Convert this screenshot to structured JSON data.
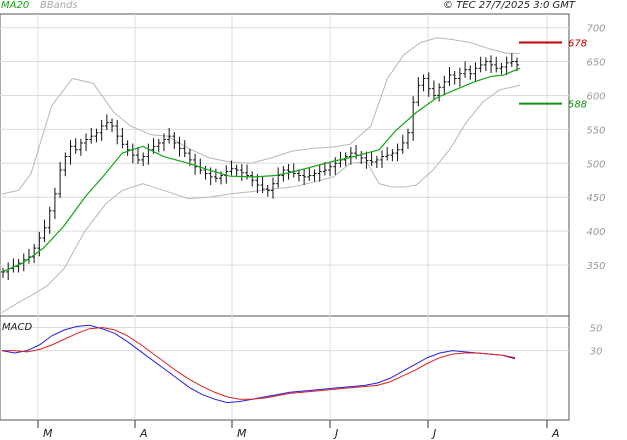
{
  "header": {
    "ma_label": "MA20",
    "bbands_label": "BBands",
    "copyright": "© TEC 27/7/2025 3:0 GMT"
  },
  "macd_label": "MACD",
  "colors": {
    "ma20": "#13a513",
    "bbands": "#b8b8b8",
    "bars": "#111111",
    "resistance": "#c00000",
    "support": "#109010",
    "macd": "#2222dd",
    "signal": "#dd2222",
    "grid": "#dcdcdc"
  },
  "chart_data": [
    {
      "type": "ohlc",
      "title": "",
      "x_tick_labels": [
        "M",
        "A",
        "M",
        "J",
        "J",
        "A"
      ],
      "y_tick_labels": [
        350,
        400,
        450,
        500,
        550,
        600,
        650,
        700
      ],
      "ylim": [
        275,
        720
      ],
      "grid": true,
      "series": [
        {
          "name": "MA20",
          "kind": "line",
          "x": [
            0,
            10,
            20,
            30,
            40,
            50,
            58,
            68,
            78,
            90,
            100,
            110,
            122,
            132,
            140,
            150,
            160,
            170,
            182,
            190,
            200,
            210,
            220,
            228,
            236,
            242,
            250
          ],
          "y": [
            340,
            353,
            375,
            408,
            450,
            485,
            515,
            525,
            510,
            500,
            490,
            481,
            480,
            482,
            487,
            495,
            503,
            510,
            520,
            548,
            575,
            597,
            610,
            620,
            628,
            630,
            640
          ]
        },
        {
          "name": "BBands upper",
          "kind": "line",
          "x": [
            0,
            8,
            14,
            24,
            34,
            44,
            54,
            62,
            72,
            80,
            90,
            100,
            110,
            120,
            130,
            140,
            150,
            160,
            168,
            178,
            186,
            194,
            202,
            210,
            218,
            226,
            236,
            244,
            250
          ],
          "y": [
            455,
            460,
            485,
            585,
            625,
            618,
            575,
            555,
            542,
            540,
            522,
            508,
            502,
            500,
            508,
            518,
            522,
            524,
            528,
            555,
            625,
            660,
            678,
            685,
            682,
            678,
            668,
            662,
            662
          ]
        },
        {
          "name": "BBands lower",
          "kind": "line",
          "x": [
            0,
            8,
            14,
            22,
            30,
            40,
            50,
            58,
            68,
            80,
            90,
            100,
            110,
            120,
            130,
            140,
            150,
            160,
            168,
            176,
            182,
            188,
            194,
            200,
            208,
            216,
            224,
            232,
            240,
            250
          ],
          "y": [
            280,
            295,
            305,
            320,
            345,
            400,
            440,
            460,
            470,
            458,
            448,
            450,
            455,
            458,
            462,
            465,
            472,
            480,
            500,
            502,
            470,
            465,
            465,
            468,
            490,
            520,
            560,
            590,
            608,
            615
          ]
        }
      ],
      "ohlc_closes": [
        340,
        345,
        348,
        353,
        358,
        362,
        375,
        390,
        405,
        430,
        455,
        490,
        510,
        525,
        520,
        530,
        535,
        540,
        545,
        555,
        560,
        555,
        540,
        528,
        520,
        512,
        505,
        510,
        520,
        525,
        530,
        535,
        540,
        530,
        522,
        515,
        505,
        495,
        490,
        485,
        480,
        478,
        482,
        488,
        492,
        490,
        486,
        482,
        475,
        468,
        462,
        460,
        470,
        482,
        490,
        488,
        485,
        482,
        480,
        482,
        485,
        488,
        490,
        495,
        500,
        505,
        510,
        515,
        512,
        508,
        504,
        502,
        505,
        510,
        512,
        515,
        520,
        530,
        545,
        590,
        615,
        625,
        610,
        600,
        612,
        620,
        630,
        625,
        632,
        638,
        632,
        640,
        645,
        650,
        645,
        640,
        642,
        648,
        650,
        645
      ],
      "resistance": 678,
      "support": 588
    },
    {
      "type": "line",
      "title": "",
      "y_tick_labels": [
        "50",
        "30"
      ],
      "ylim": [
        -30,
        60
      ],
      "grid": true,
      "series": [
        {
          "name": "MACD",
          "values": [
            30,
            28,
            30,
            35,
            43,
            48,
            51,
            52,
            49,
            45,
            38,
            30,
            22,
            14,
            6,
            -2,
            -8,
            -12,
            -15,
            -14,
            -12,
            -10,
            -8,
            -6,
            -5,
            -4,
            -3,
            -2,
            -1,
            0,
            2,
            6,
            12,
            18,
            24,
            28,
            30,
            29,
            28,
            27,
            26,
            23
          ]
        },
        {
          "name": "Signal",
          "values": [
            30,
            30,
            29,
            31,
            35,
            40,
            45,
            49,
            50,
            48,
            43,
            36,
            28,
            20,
            12,
            5,
            -1,
            -6,
            -10,
            -12,
            -12,
            -11,
            -9,
            -7,
            -6,
            -5,
            -4,
            -3,
            -2,
            -1,
            0,
            3,
            8,
            13,
            19,
            24,
            27,
            28,
            28,
            27,
            26,
            24
          ]
        }
      ]
    }
  ]
}
